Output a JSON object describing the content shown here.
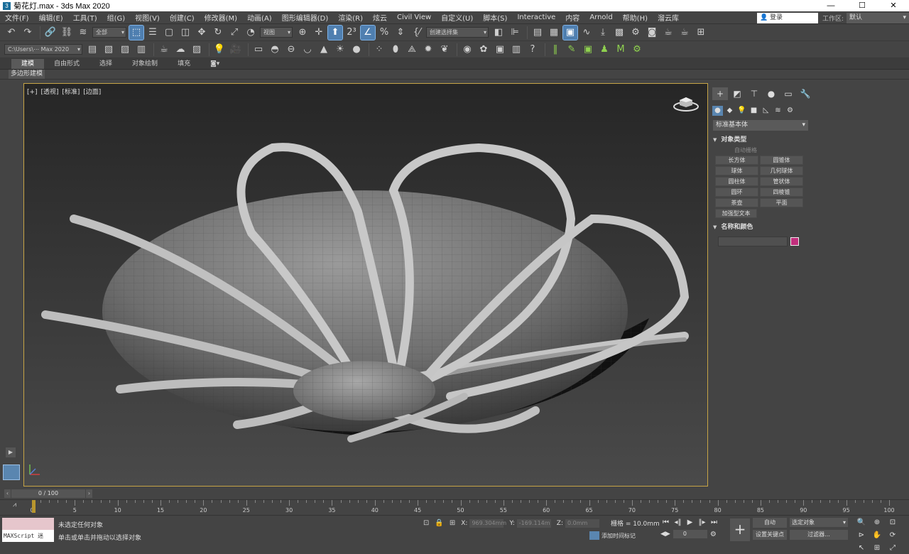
{
  "window": {
    "title": "菊花灯.max - 3ds Max 2020",
    "minimize": "—",
    "maximize": "☐",
    "close": "✕"
  },
  "menu": {
    "items": [
      "文件(F)",
      "编辑(E)",
      "工具(T)",
      "组(G)",
      "视图(V)",
      "创建(C)",
      "修改器(M)",
      "动画(A)",
      "图形编辑器(D)",
      "渲染(R)",
      "炫云",
      "Civil View",
      "自定义(U)",
      "脚本(S)",
      "Interactive",
      "内容",
      "Arnold",
      "帮助(H)",
      "溜云库"
    ],
    "login": "登录",
    "workspace_label": "工作区:",
    "workspace_value": "默认"
  },
  "toolbar1": {
    "filter_dropdown": "全部",
    "view_dropdown": "视图",
    "selection_set": "创建选择集"
  },
  "toolbar2": {
    "path_dropdown": "C:\\Users\\⋯ Max 2020"
  },
  "ribbon": {
    "tabs": [
      "建模",
      "自由形式",
      "选择",
      "对象绘制",
      "填充"
    ],
    "extra": "◙▾",
    "subtitle": "多边形建模"
  },
  "viewport": {
    "labels": [
      "[+]",
      "[透视]",
      "[标准]",
      "[边面]"
    ]
  },
  "command_panel": {
    "category": "标准基本体",
    "rollout_object_type": "对象类型",
    "autogrid": "自动栅格",
    "objects": [
      "长方体",
      "圆锥体",
      "球体",
      "几何球体",
      "圆柱体",
      "管状体",
      "圆环",
      "四棱锥",
      "茶壶",
      "平面"
    ],
    "text_plus": "加强型文本",
    "rollout_name_color": "名称和颜色",
    "object_color": "#c22f7d"
  },
  "timeline": {
    "slider": "0 / 100",
    "ticks": [
      "0",
      "5",
      "10",
      "15",
      "20",
      "25",
      "30",
      "35",
      "40",
      "45",
      "50",
      "55",
      "60",
      "65",
      "70",
      "75",
      "80",
      "85",
      "90",
      "95",
      "100"
    ]
  },
  "status": {
    "maxscript": "MAXScript 迷",
    "selection": "未选定任何对象",
    "prompt": "单击或单击并拖动以选择对象",
    "x_label": "X:",
    "x_value": "969.304mm",
    "y_label": "Y:",
    "y_value": "-169.114m",
    "z_label": "Z:",
    "z_value": "0.0mm",
    "grid": "栅格 = 10.0mm",
    "add_time_tag": "添加时间标记",
    "frame": "0",
    "auto_key": "自动",
    "set_key": "设置关键点",
    "selected_objects": "选定对象",
    "filters": "过滤器..."
  }
}
